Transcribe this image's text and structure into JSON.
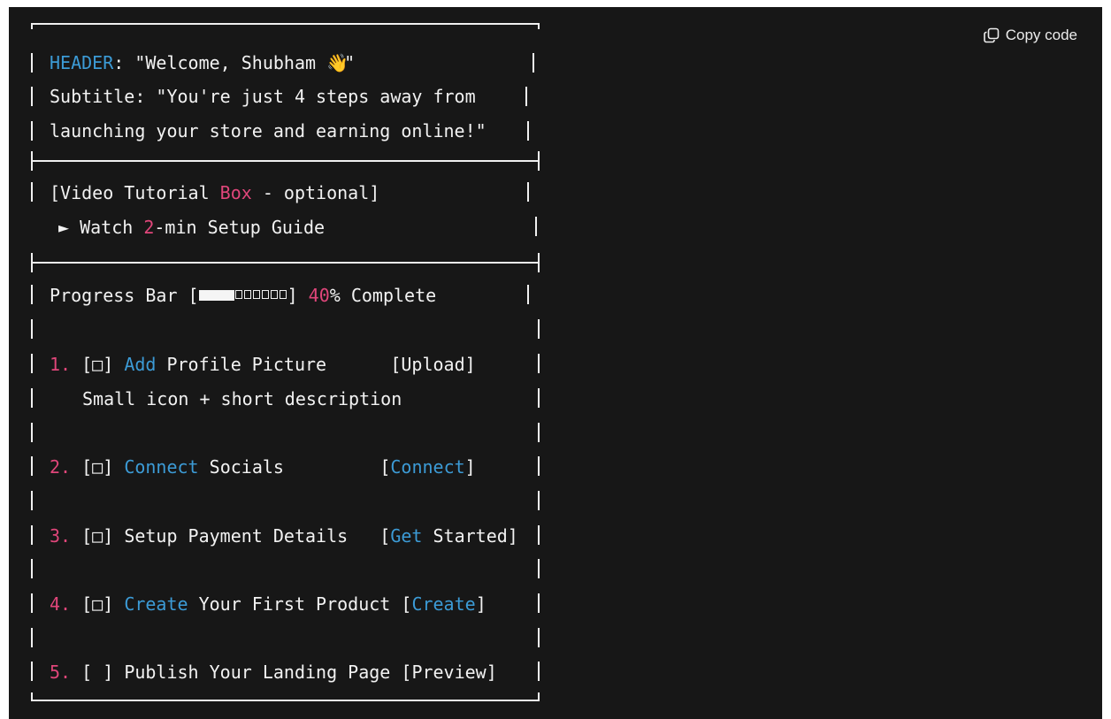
{
  "toolbar": {
    "copy_label": "Copy code"
  },
  "header": {
    "key": "HEADER",
    "sep": ": \"Welcome, Shubham ",
    "emoji": "👋",
    "end": "\""
  },
  "subtitle": {
    "line1": "Subtitle: \"You're just 4 steps away from",
    "line2": "launching your store and earning online!\""
  },
  "video": {
    "l1_pre": "[Video Tutorial ",
    "l1_box": "Box",
    "l1_post": " - optional]",
    "l2_pre": "► Watch ",
    "l2_num": "2",
    "l2_post": "-min Setup Guide"
  },
  "progress": {
    "pre": "Progress Bar [",
    "post": "] ",
    "value_text": "40",
    "suffix": "% Complete",
    "percent": 40
  },
  "steps": [
    {
      "num": "1.",
      "box": " [□] ",
      "kw": "Add",
      "rest": " Profile Picture      ",
      "b_open": "[",
      "b_kw": "",
      "b_rest": "Upload",
      "b_close": "]",
      "sub": "Small icon + short description"
    },
    {
      "num": "2.",
      "box": " [□] ",
      "kw": "Connect",
      "rest": " Socials         ",
      "b_open": "[",
      "b_kw": "Connect",
      "b_rest": "",
      "b_close": "]"
    },
    {
      "num": "3.",
      "box": " [□] ",
      "kw": "",
      "rest": "Setup Payment Details   ",
      "b_open": "[",
      "b_kw": "Get",
      "b_rest": " Started",
      "b_close": "]"
    },
    {
      "num": "4.",
      "box": " [□] ",
      "kw": "Create",
      "rest": " Your First Product ",
      "b_open": "[",
      "b_kw": "Create",
      "b_rest": "",
      "b_close": "]"
    },
    {
      "num": "5.",
      "box": " [ ] ",
      "kw": "",
      "rest": "Publish Your Landing Page ",
      "b_open": "[",
      "b_kw": "",
      "b_rest": "Preview",
      "b_close": "]"
    }
  ]
}
